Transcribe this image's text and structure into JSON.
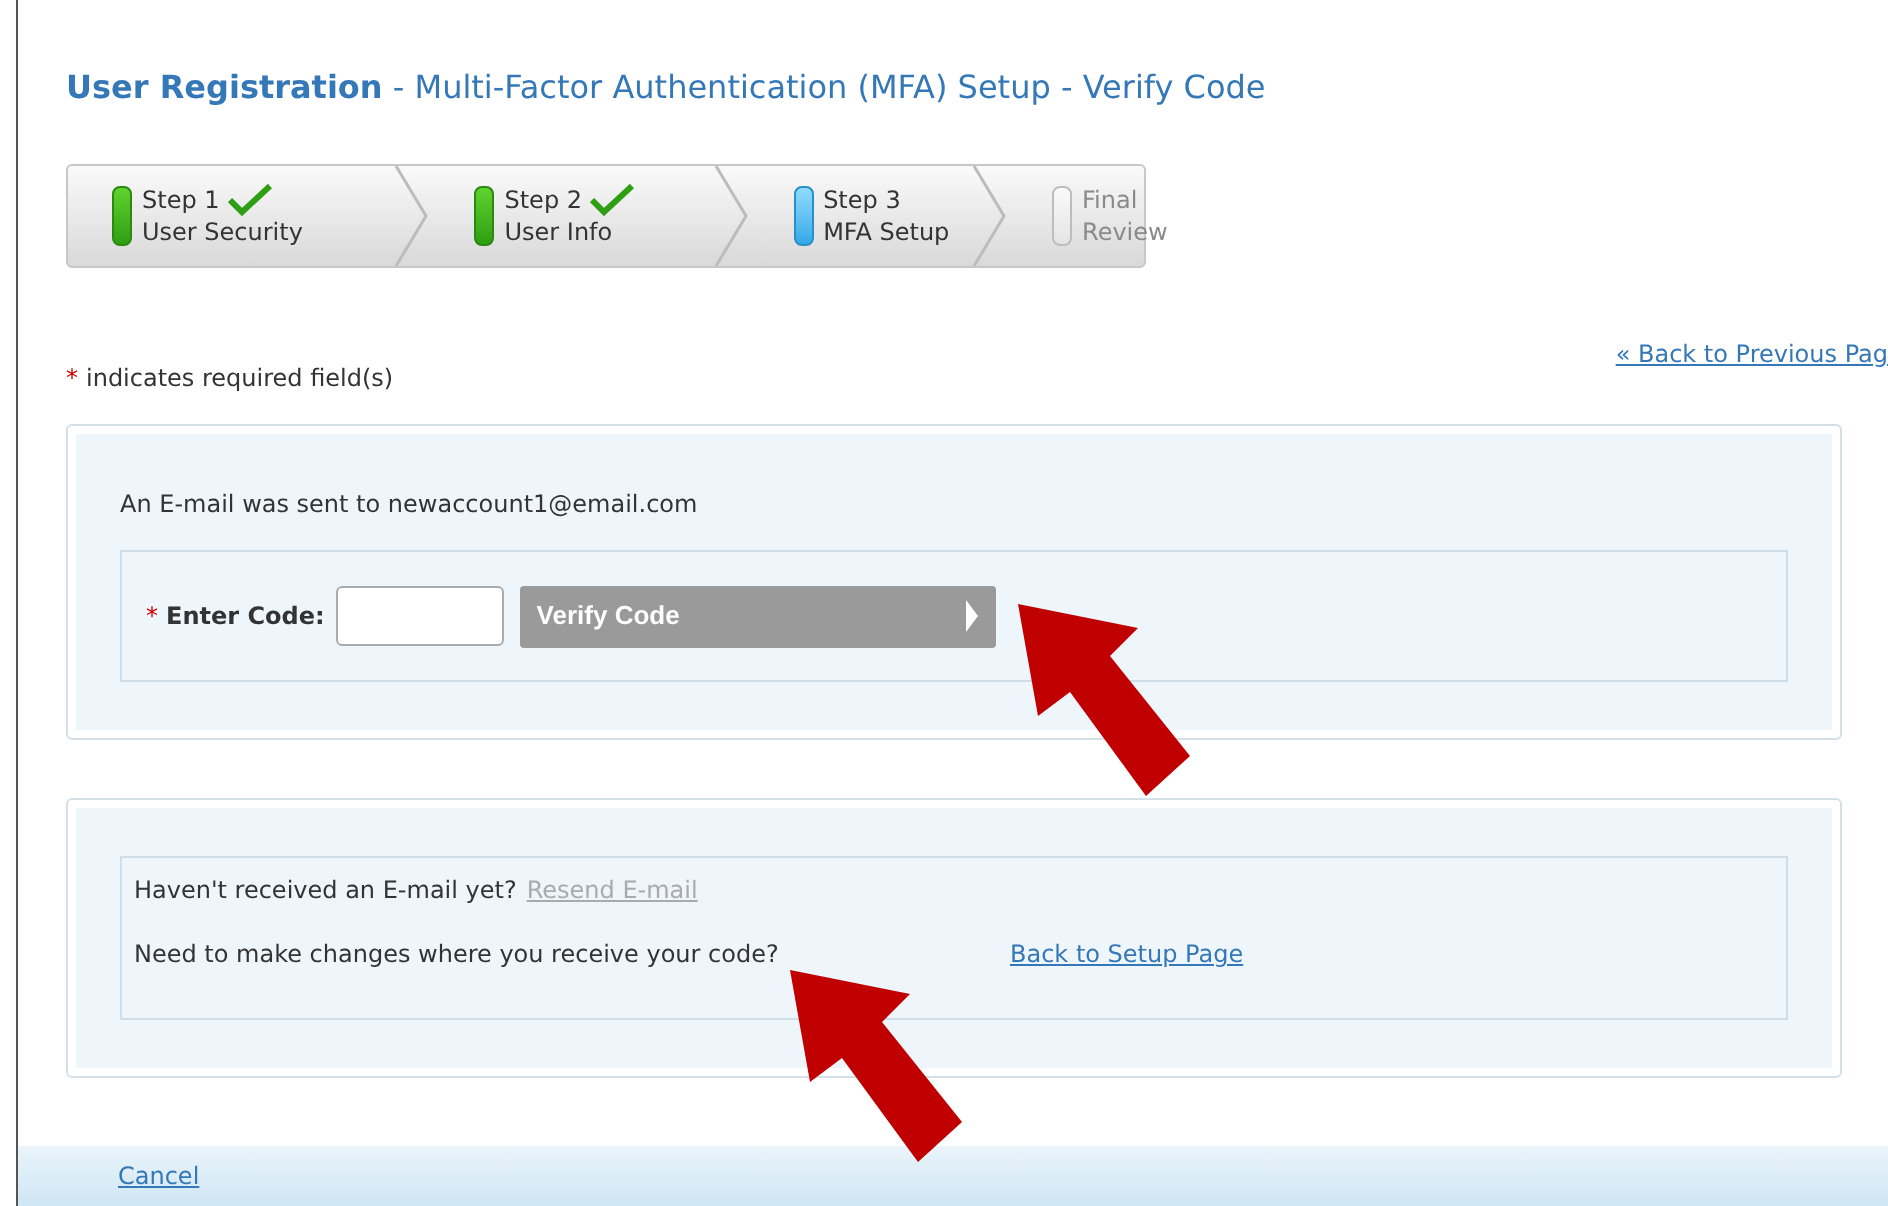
{
  "title": "**User Registration** - Multi-Factor Authentication (MFA) Setup - Verify Code",
  "steps": [
    {
      "label": "Step 1",
      "sublabel": "User Security",
      "kind": "complete"
    },
    {
      "label": "Step 2",
      "sublabel": "User Info",
      "kind": "complete"
    },
    {
      "label": "Step 3",
      "sublabel": "MFA Setup",
      "kind": "current"
    },
    {
      "label": "Final",
      "sublabel": "Review",
      "kind": "pending"
    }
  ],
  "required_note": {
    "mark": "*",
    "text": "indicates required field(s)"
  },
  "back_link": "« Back to Previous Pag",
  "verify_panel": {
    "message": "An E-mail was sent to newaccount1@email.com",
    "field_label": "Enter Code:",
    "required_mark": "*",
    "button": "Verify Code",
    "button_disabled": true
  },
  "help_panel": {
    "resend_text": "Haven't received an E-mail yet?",
    "resend_link": "Resend E-mail",
    "resend_disabled": true,
    "change_text": "Need to make changes where you receive your code?",
    "change_link": "Back to Setup Page"
  },
  "footer": {
    "cancel": "Cancel"
  }
}
